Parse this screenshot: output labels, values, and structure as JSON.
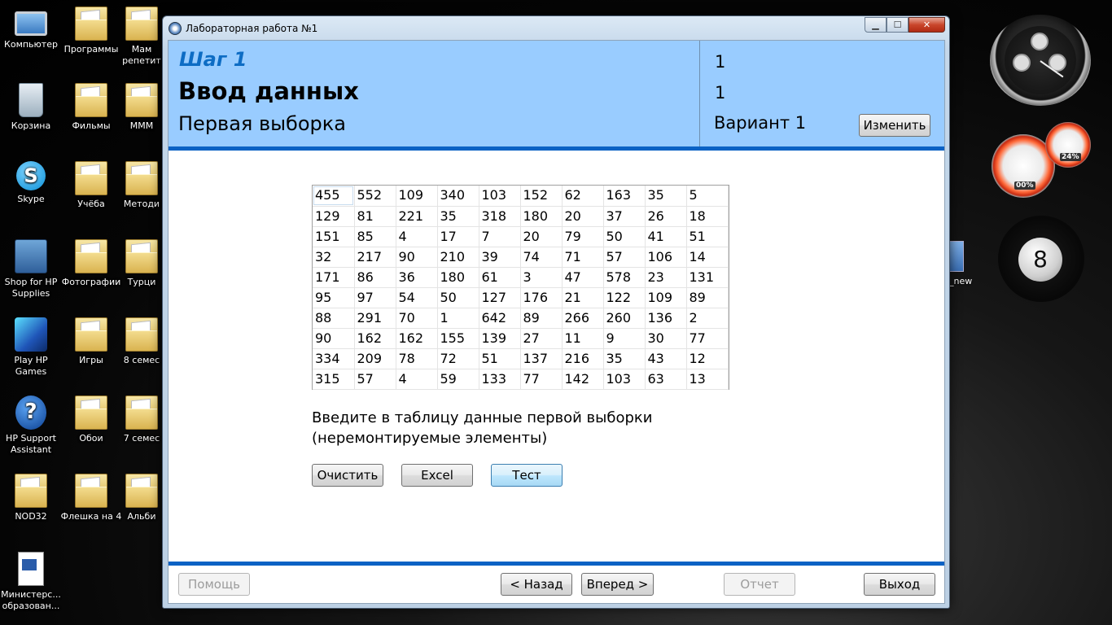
{
  "desktop": {
    "icons": [
      {
        "label": "Компьютер",
        "icon": "computer-icon"
      },
      {
        "label": "Программы",
        "icon": "folder-icon"
      },
      {
        "label": "Мам репетит",
        "icon": "folder-icon"
      },
      {
        "label": "Корзина",
        "icon": "recycle-bin-icon"
      },
      {
        "label": "Фильмы",
        "icon": "folder-icon"
      },
      {
        "label": "МММ",
        "icon": "folder-icon"
      },
      {
        "label": "Skype",
        "icon": "skype-icon"
      },
      {
        "label": "Учёба",
        "icon": "folder-icon"
      },
      {
        "label": "Методи",
        "icon": "folder-icon"
      },
      {
        "label": "Shop for HP Supplies",
        "icon": "printer-icon"
      },
      {
        "label": "Фотографии",
        "icon": "folder-icon"
      },
      {
        "label": "Турци",
        "icon": "folder-icon"
      },
      {
        "label": "Play HP Games",
        "icon": "hp-games-icon"
      },
      {
        "label": "Игры",
        "icon": "folder-icon"
      },
      {
        "label": "8 семес",
        "icon": "folder-icon"
      },
      {
        "label": "HP Support Assistant",
        "icon": "help-icon"
      },
      {
        "label": "Обои",
        "icon": "folder-icon"
      },
      {
        "label": "7 семес",
        "icon": "folder-icon"
      },
      {
        "label": "NOD32",
        "icon": "folder-icon"
      },
      {
        "label": "Флешка на 4",
        "icon": "folder-icon"
      },
      {
        "label": "Альби",
        "icon": "folder-icon"
      },
      {
        "label": "Министерс... образован...",
        "icon": "word-document-icon"
      }
    ],
    "side_icon_label": "_new",
    "gadgets": {
      "cpu_percent": "00%",
      "ram_percent": "24%",
      "eight_ball": "8"
    }
  },
  "window": {
    "title": "Лабораторная работа №1",
    "controls": {
      "minimize": "▁",
      "maximize": "☐",
      "close": "✕"
    }
  },
  "header": {
    "step_label": "Шаг 1",
    "step_title": "Ввод данных",
    "step_subtitle": "Первая выборка",
    "info_line1": "1",
    "info_line2": "1",
    "variant": "Вариант 1",
    "change_button": "Изменить"
  },
  "grid": {
    "rows": [
      [
        "455",
        "552",
        "109",
        "340",
        "103",
        "152",
        "62",
        "163",
        "35",
        "5"
      ],
      [
        "129",
        "81",
        "221",
        "35",
        "318",
        "180",
        "20",
        "37",
        "26",
        "18"
      ],
      [
        "151",
        "85",
        "4",
        "17",
        "7",
        "20",
        "79",
        "50",
        "41",
        "51"
      ],
      [
        "32",
        "217",
        "90",
        "210",
        "39",
        "74",
        "71",
        "57",
        "106",
        "14"
      ],
      [
        "171",
        "86",
        "36",
        "180",
        "61",
        "3",
        "47",
        "578",
        "23",
        "131"
      ],
      [
        "95",
        "97",
        "54",
        "50",
        "127",
        "176",
        "21",
        "122",
        "109",
        "89"
      ],
      [
        "88",
        "291",
        "70",
        "1",
        "642",
        "89",
        "266",
        "260",
        "136",
        "2"
      ],
      [
        "90",
        "162",
        "162",
        "155",
        "139",
        "27",
        "11",
        "9",
        "30",
        "77"
      ],
      [
        "334",
        "209",
        "78",
        "72",
        "51",
        "137",
        "216",
        "35",
        "43",
        "12"
      ],
      [
        "315",
        "57",
        "4",
        "59",
        "133",
        "77",
        "142",
        "103",
        "63",
        "13"
      ]
    ]
  },
  "instruction": {
    "line1": "Введите в таблицу данные первой выборки",
    "line2": "(неремонтируемые элементы)"
  },
  "actions": {
    "clear": "Очистить",
    "excel": "Excel",
    "test": "Тест"
  },
  "footer": {
    "help": "Помощь",
    "back": "< Назад",
    "next": "Вперед >",
    "report": "Отчет",
    "exit": "Выход"
  },
  "colors": {
    "header_bg": "#99ccff",
    "step_label": "#0d6cc4",
    "accent_bar": "#0b62c4"
  }
}
